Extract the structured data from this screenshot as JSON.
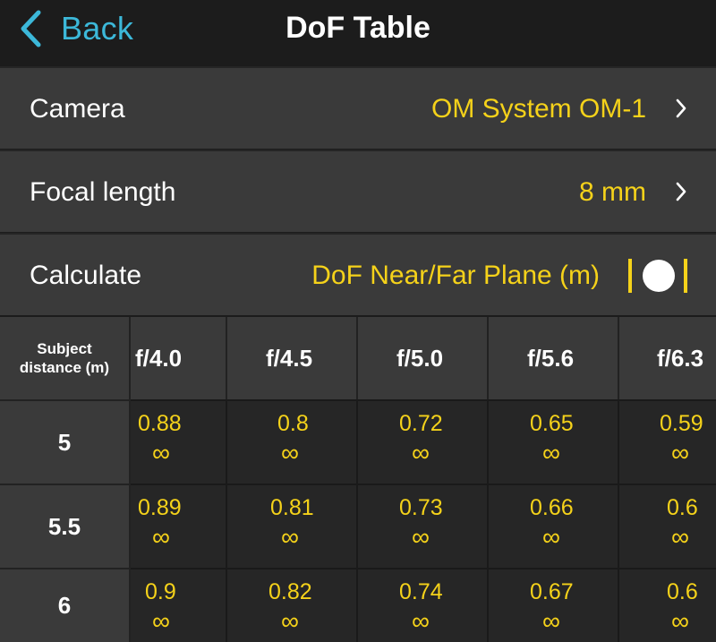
{
  "navbar": {
    "back_label": "Back",
    "title": "DoF Table"
  },
  "settings": [
    {
      "label": "Camera",
      "value": "OM System OM-1"
    },
    {
      "label": "Focal length",
      "value": "8 mm"
    },
    {
      "label": "Calculate",
      "value": "DoF Near/Far Plane (m)"
    }
  ],
  "table": {
    "corner_label_line1": "Subject",
    "corner_label_line2": "distance (m)",
    "apertures": [
      "f/4.0",
      "f/4.5",
      "f/5.0",
      "f/5.6",
      "f/6.3"
    ],
    "rows": [
      {
        "distance": "5",
        "cells": [
          {
            "near": "0.88",
            "far": "∞"
          },
          {
            "near": "0.8",
            "far": "∞"
          },
          {
            "near": "0.72",
            "far": "∞"
          },
          {
            "near": "0.65",
            "far": "∞"
          },
          {
            "near": "0.59",
            "far": "∞"
          }
        ]
      },
      {
        "distance": "5.5",
        "cells": [
          {
            "near": "0.89",
            "far": "∞"
          },
          {
            "near": "0.81",
            "far": "∞"
          },
          {
            "near": "0.73",
            "far": "∞"
          },
          {
            "near": "0.66",
            "far": "∞"
          },
          {
            "near": "0.6",
            "far": "∞"
          }
        ]
      },
      {
        "distance": "6",
        "cells": [
          {
            "near": "0.9",
            "far": "∞"
          },
          {
            "near": "0.82",
            "far": "∞"
          },
          {
            "near": "0.74",
            "far": "∞"
          },
          {
            "near": "0.67",
            "far": "∞"
          },
          {
            "near": "0.6",
            "far": "∞"
          }
        ]
      }
    ]
  },
  "colors": {
    "accent": "#f5d21a",
    "back": "#3cb8d9",
    "row_bg": "#3a3a3a",
    "cell_bg": "#262626"
  },
  "icons": {
    "back": "chevron-left-icon",
    "disclosure": "chevron-right-icon"
  }
}
